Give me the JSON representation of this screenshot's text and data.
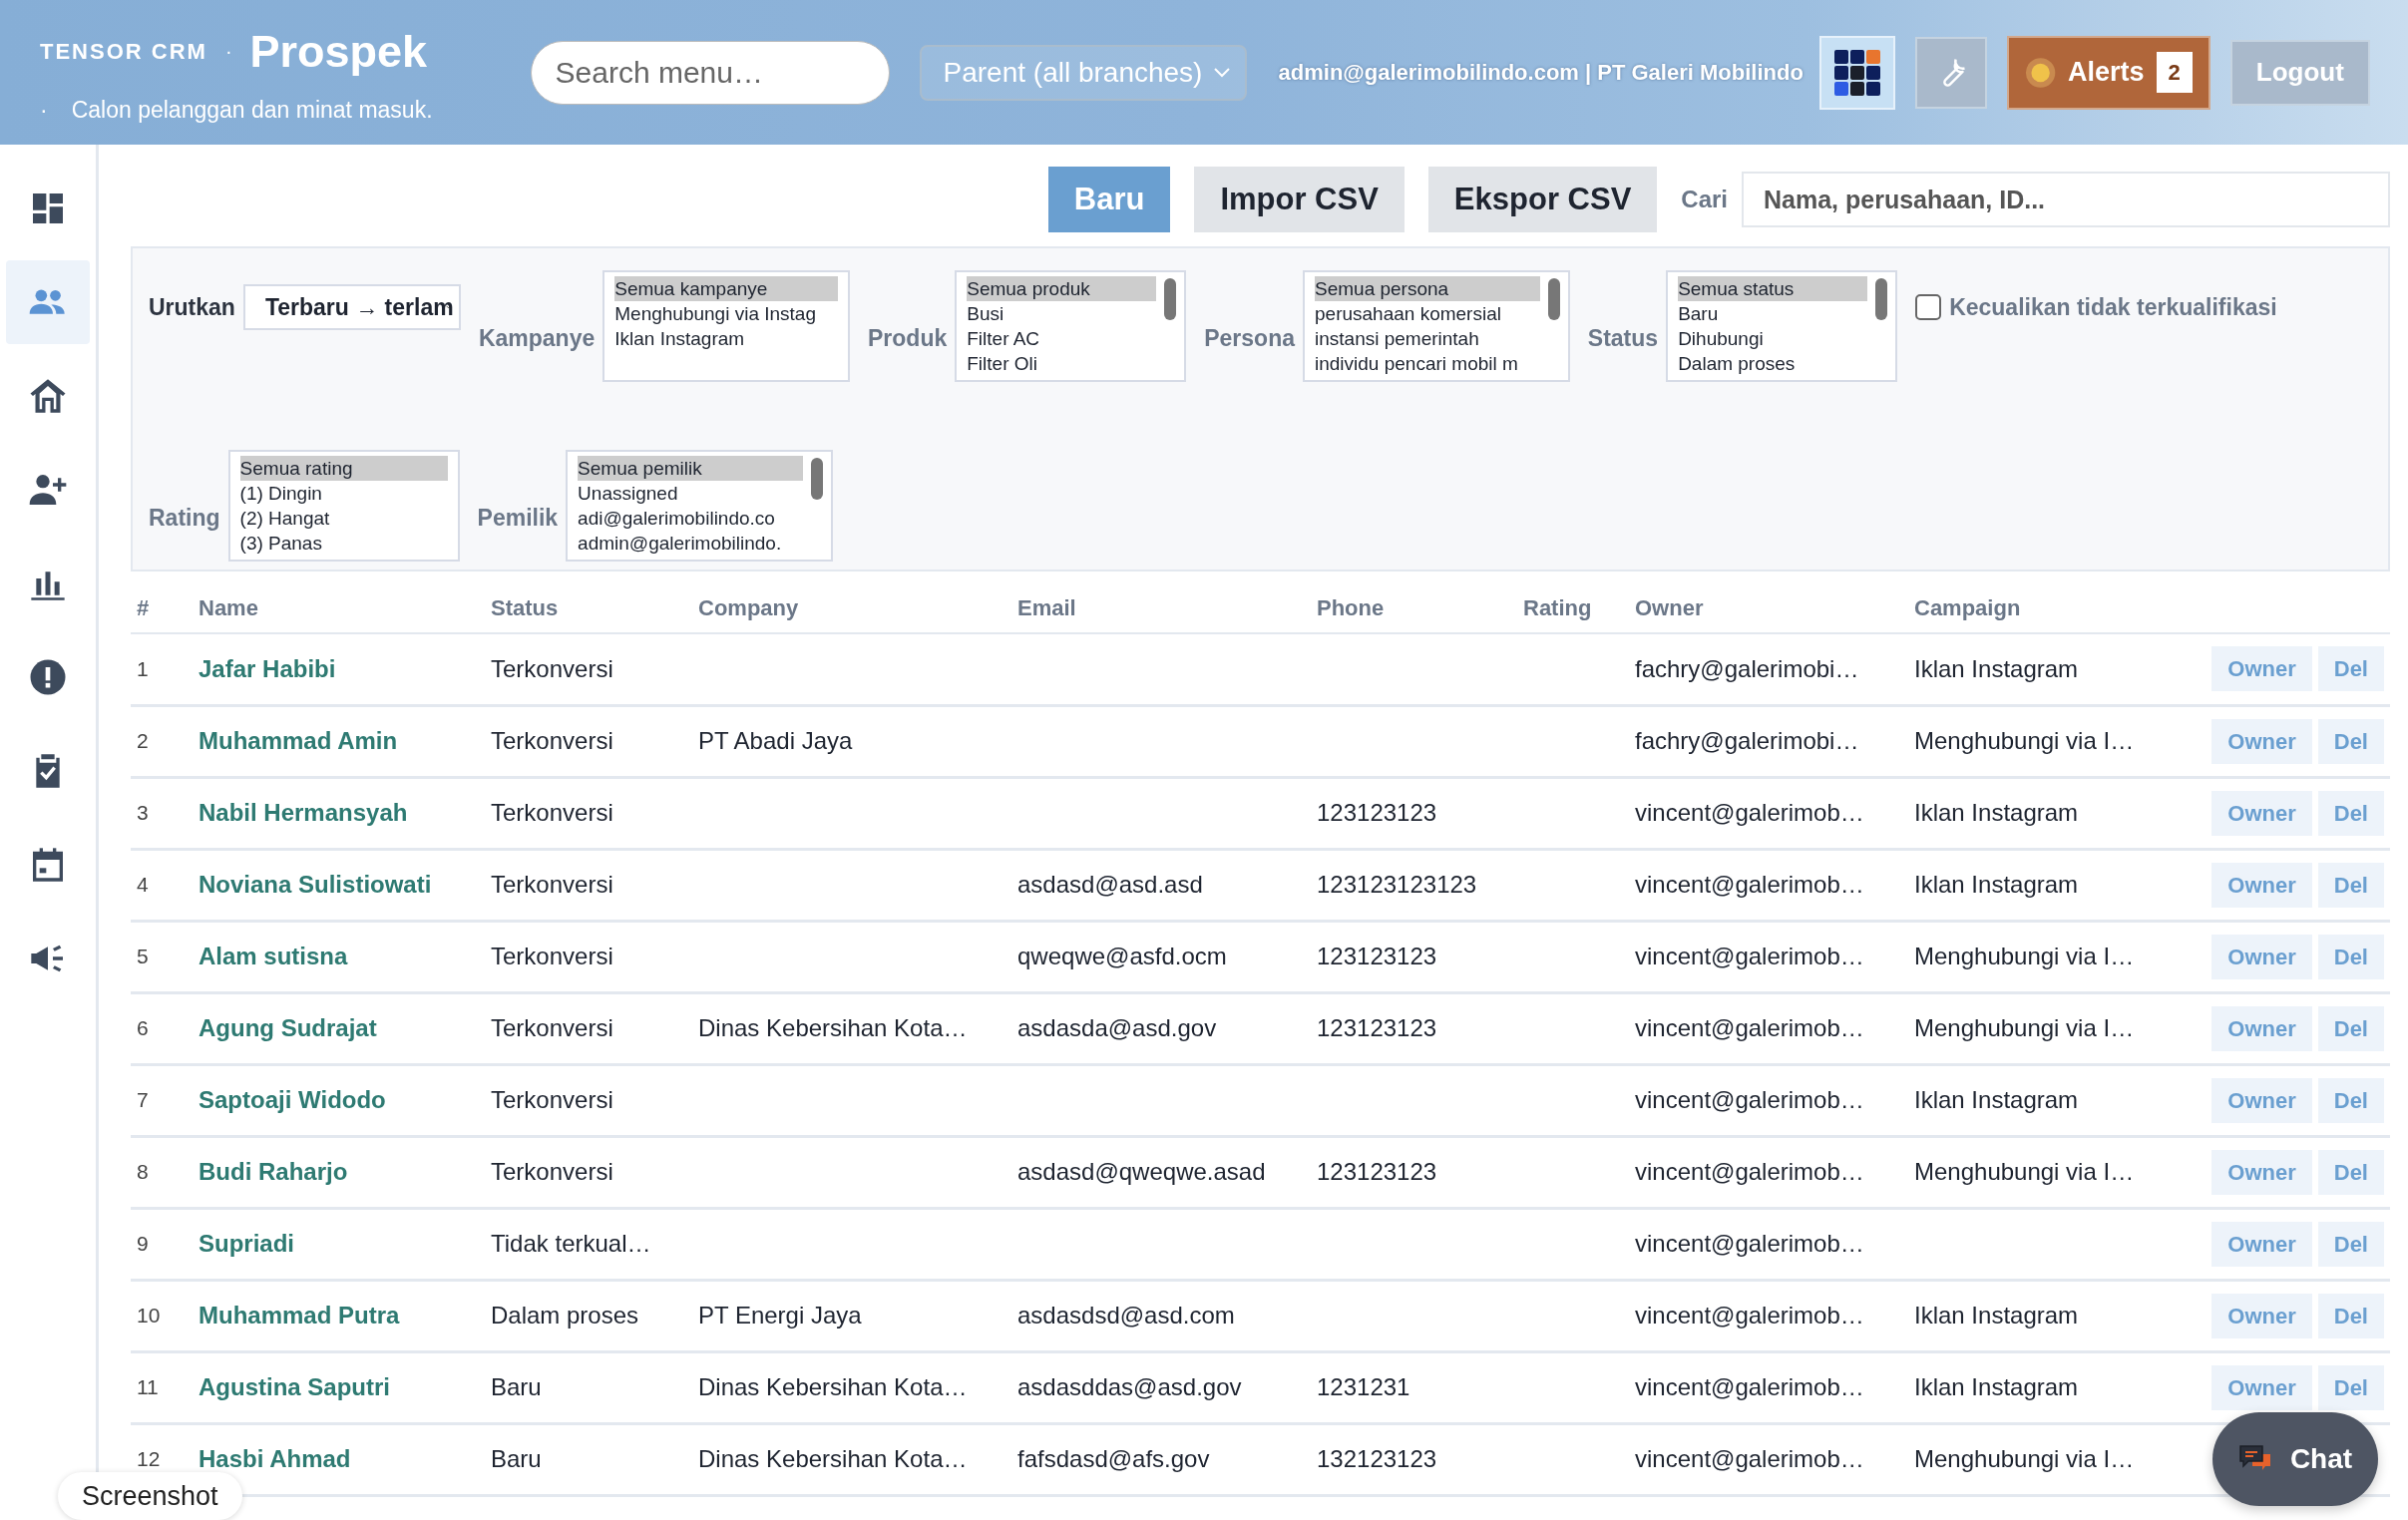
{
  "header": {
    "brand": "TENSOR CRM",
    "separator": "·",
    "title": "Prospek",
    "subtitle_mark": "·",
    "subtitle": "Calon pelanggan dan minat masuk.",
    "search": {
      "placeholder": "Search menu…"
    },
    "branch": "Parent (all branches)",
    "user": "admin@galerimobilindo.com | PT Galeri Mobilindo",
    "alerts": {
      "label": "Alerts",
      "count": "2"
    },
    "logout": "Logout"
  },
  "sidebar": {
    "items": [
      {
        "kind": "dashboard",
        "selected": false
      },
      {
        "kind": "people",
        "selected": true
      },
      {
        "kind": "house",
        "selected": false
      },
      {
        "kind": "person-add",
        "selected": false
      },
      {
        "kind": "chart",
        "selected": false
      },
      {
        "kind": "alert",
        "selected": false
      },
      {
        "kind": "clipboard",
        "selected": false
      },
      {
        "kind": "calendar",
        "selected": false
      },
      {
        "kind": "megaphone",
        "selected": false
      }
    ]
  },
  "toolbar": {
    "buttons": [
      {
        "label": "Baru",
        "kind": "primary"
      },
      {
        "label": "Impor CSV",
        "kind": "secondary"
      },
      {
        "label": "Ekspor CSV",
        "kind": "secondary"
      }
    ],
    "search_label": "Cari",
    "search_placeholder": "Nama, perusahaan, ID..."
  },
  "filters": {
    "sort": {
      "label": "Urutkan",
      "value": "Terbaru → terlam"
    },
    "lists": [
      {
        "label": "Kampanye",
        "scrollbar": false,
        "options": [
          {
            "text": "Semua kampanye",
            "selected": true
          },
          {
            "text": "Menghubungi via Instag",
            "selected": false
          },
          {
            "text": "Iklan Instagram",
            "selected": false
          }
        ]
      },
      {
        "label": "Produk",
        "scrollbar": true,
        "options": [
          {
            "text": "Semua produk",
            "selected": true
          },
          {
            "text": "Busi",
            "selected": false
          },
          {
            "text": "Filter AC",
            "selected": false
          },
          {
            "text": "Filter Oli",
            "selected": false
          }
        ]
      },
      {
        "label": "Persona",
        "scrollbar": true,
        "options": [
          {
            "text": "Semua persona",
            "selected": true
          },
          {
            "text": "perusahaan komersial",
            "selected": false
          },
          {
            "text": "instansi pemerintah",
            "selected": false
          },
          {
            "text": "individu pencari mobil m",
            "selected": false
          }
        ]
      },
      {
        "label": "Status",
        "scrollbar": true,
        "options": [
          {
            "text": "Semua status",
            "selected": true
          },
          {
            "text": "Baru",
            "selected": false
          },
          {
            "text": "Dihubungi",
            "selected": false
          },
          {
            "text": "Dalam proses",
            "selected": false
          }
        ]
      },
      {
        "label": "Rating",
        "scrollbar": false,
        "options": [
          {
            "text": "Semua rating",
            "selected": true
          },
          {
            "text": "(1) Dingin",
            "selected": false
          },
          {
            "text": "(2) Hangat",
            "selected": false
          },
          {
            "text": "(3) Panas",
            "selected": false
          }
        ]
      },
      {
        "label": "Pemilik",
        "scrollbar": true,
        "options": [
          {
            "text": "Semua pemilik",
            "selected": true
          },
          {
            "text": "Unassigned",
            "selected": false
          },
          {
            "text": "adi@galerimobilindo.co",
            "selected": false
          },
          {
            "text": "admin@galerimobilindo.",
            "selected": false
          }
        ]
      }
    ],
    "exclude": {
      "label": "Kecualikan tidak terkualifikasi",
      "checked": false
    }
  },
  "table": {
    "columns": [
      "#",
      "Name",
      "Status",
      "Company",
      "Email",
      "Phone",
      "Rating",
      "Owner",
      "Campaign"
    ],
    "rows": [
      {
        "cells": [
          "1",
          "Jafar Habibi",
          "Terkonversi",
          "",
          "",
          "",
          "",
          "fachry@galerimobi…",
          "Iklan Instagram"
        ],
        "actions": [
          "Owner",
          "Del"
        ]
      },
      {
        "cells": [
          "2",
          "Muhammad Amin",
          "Terkonversi",
          "PT Abadi Jaya",
          "",
          "",
          "",
          "fachry@galerimobi…",
          "Menghubungi via I…"
        ],
        "actions": [
          "Owner",
          "Del"
        ]
      },
      {
        "cells": [
          "3",
          "Nabil Hermansyah",
          "Terkonversi",
          "",
          "",
          "123123123",
          "",
          "vincent@galerimob…",
          "Iklan Instagram"
        ],
        "actions": [
          "Owner",
          "Del"
        ]
      },
      {
        "cells": [
          "4",
          "Noviana Sulistiowati",
          "Terkonversi",
          "",
          "asdasd@asd.asd",
          "123123123123",
          "",
          "vincent@galerimob…",
          "Iklan Instagram"
        ],
        "actions": [
          "Owner",
          "Del"
        ]
      },
      {
        "cells": [
          "5",
          "Alam sutisna",
          "Terkonversi",
          "",
          "qweqwe@asfd.ocm",
          "123123123",
          "",
          "vincent@galerimob…",
          "Menghubungi via I…"
        ],
        "actions": [
          "Owner",
          "Del"
        ]
      },
      {
        "cells": [
          "6",
          "Agung Sudrajat",
          "Terkonversi",
          "Dinas Kebersihan Kota…",
          "asdasda@asd.gov",
          "123123123",
          "",
          "vincent@galerimob…",
          "Menghubungi via I…"
        ],
        "actions": [
          "Owner",
          "Del"
        ]
      },
      {
        "cells": [
          "7",
          "Saptoaji Widodo",
          "Terkonversi",
          "",
          "",
          "",
          "",
          "vincent@galerimob…",
          "Iklan Instagram"
        ],
        "actions": [
          "Owner",
          "Del"
        ]
      },
      {
        "cells": [
          "8",
          "Budi Raharjo",
          "Terkonversi",
          "",
          "asdasd@qweqwe.asad",
          "123123123",
          "",
          "vincent@galerimob…",
          "Menghubungi via I…"
        ],
        "actions": [
          "Owner",
          "Del"
        ]
      },
      {
        "cells": [
          "9",
          "Supriadi",
          "Tidak terkual…",
          "",
          "",
          "",
          "",
          "vincent@galerimob…",
          ""
        ],
        "actions": [
          "Owner",
          "Del"
        ]
      },
      {
        "cells": [
          "10",
          "Muhammad Putra",
          "Dalam proses",
          "PT Energi Jaya",
          "asdasdsd@asd.com",
          "",
          "",
          "vincent@galerimob…",
          "Iklan Instagram"
        ],
        "actions": [
          "Owner",
          "Del"
        ]
      },
      {
        "cells": [
          "11",
          "Agustina Saputri",
          "Baru",
          "Dinas Kebersihan Kota…",
          "asdasddas@asd.gov",
          "1231231",
          "",
          "vincent@galerimob…",
          "Iklan Instagram"
        ],
        "actions": [
          "Owner",
          "Del"
        ]
      },
      {
        "cells": [
          "12",
          "Hasbi Ahmad",
          "Baru",
          "Dinas Kebersihan Kota…",
          "fafsdasd@afs.gov",
          "132123123",
          "",
          "vincent@galerimob…",
          "Menghubungi via I…"
        ]
      }
    ]
  },
  "chat": {
    "label": "Chat"
  },
  "tooltip": "Screenshot"
}
